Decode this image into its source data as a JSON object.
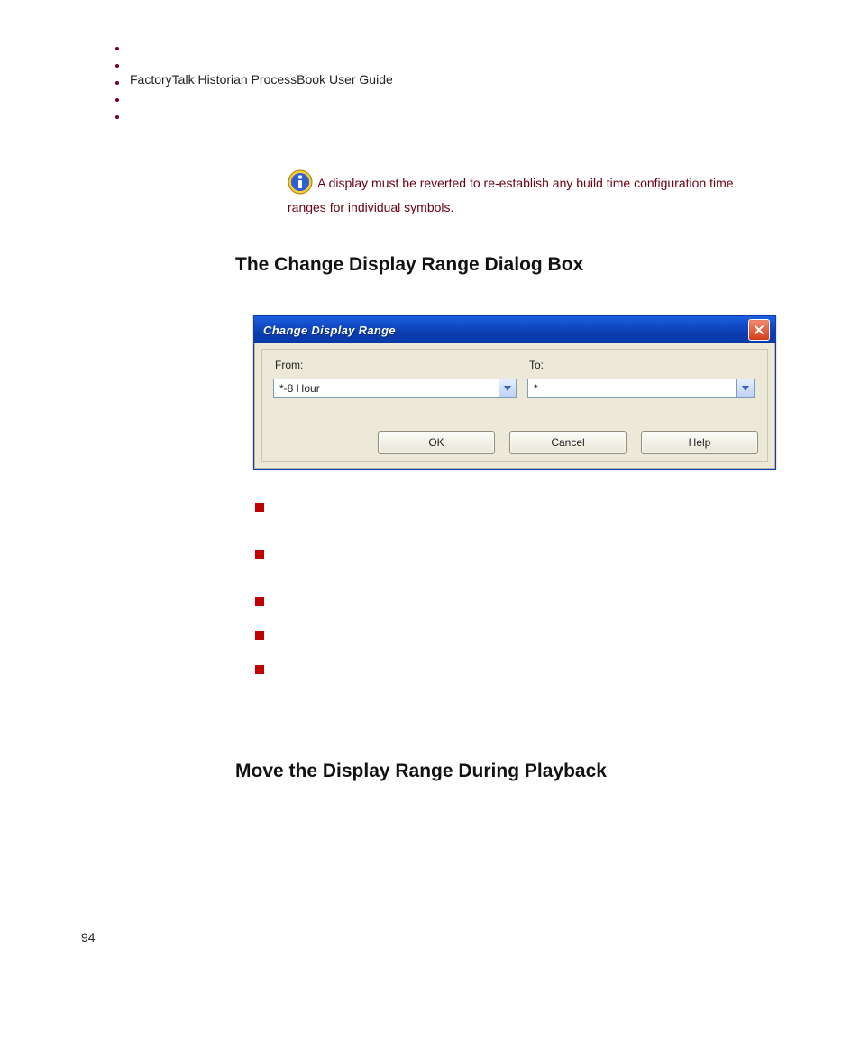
{
  "header": "FactoryTalk Historian ProcessBook User Guide",
  "note": {
    "text": "A display must be reverted to re-establish any build time configuration time ranges for individual symbols."
  },
  "section1_title": "The Change Display Range Dialog Box",
  "dialog": {
    "title": "Change Display Range",
    "from_label": "From:",
    "to_label": "To:",
    "from_value": "*-8 Hour",
    "to_value": "*",
    "ok": "OK",
    "cancel": "Cancel",
    "help": "Help"
  },
  "section2_title": "Move the Display Range During Playback",
  "page_number": "94"
}
